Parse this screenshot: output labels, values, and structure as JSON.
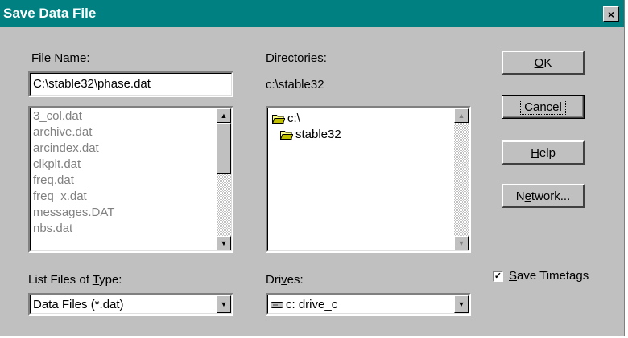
{
  "window": {
    "title": "Save Data File",
    "close_label": "×"
  },
  "file_name": {
    "label_pre": "File ",
    "label_key": "N",
    "label_post": "ame:",
    "value": "C:\\stable32\\phase.dat",
    "files": [
      "3_col.dat",
      "archive.dat",
      "arcindex.dat",
      "clkplt.dat",
      "freq.dat",
      "freq_x.dat",
      "messages.DAT",
      "nbs.dat"
    ]
  },
  "directories": {
    "label_key": "D",
    "label_post": "irectories:",
    "current": "c:\\stable32",
    "items": [
      {
        "name": "c:\\",
        "icon": "open-folder-icon"
      },
      {
        "name": "stable32",
        "icon": "open-folder-icon"
      }
    ]
  },
  "file_type": {
    "label_pre": "List Files of ",
    "label_key": "T",
    "label_post": "ype:",
    "value": "Data Files (*.dat)"
  },
  "drives": {
    "label_pre": "Dri",
    "label_key": "v",
    "label_post": "es:",
    "value": "c: drive_c",
    "icon": "drive-icon"
  },
  "buttons": {
    "ok": {
      "key": "O",
      "rest": "K"
    },
    "cancel": {
      "key": "C",
      "rest": "ancel"
    },
    "help": {
      "key": "H",
      "rest": "elp"
    },
    "network": {
      "pre": "N",
      "key": "e",
      "rest": "twork..."
    }
  },
  "save_timetags": {
    "key": "S",
    "rest": "ave Timetags",
    "checked": true,
    "mark": "✓"
  },
  "colors": {
    "titlebar": "#008080",
    "face": "#c0c0c0",
    "disabled_text": "#808080"
  }
}
